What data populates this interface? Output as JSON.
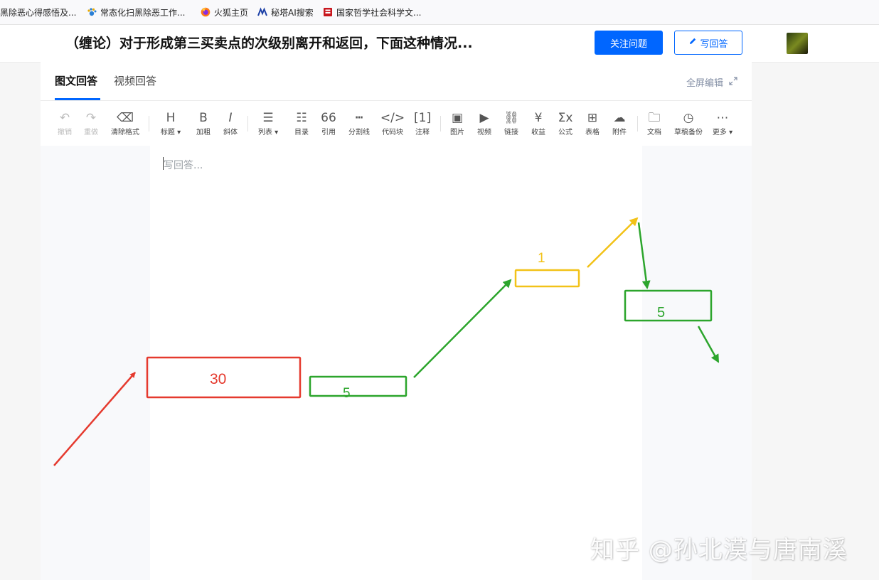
{
  "bookmarks": [
    {
      "icon": "page-icon",
      "label": "黑除恶心得感悟及..."
    },
    {
      "icon": "paw-icon",
      "label": "常态化扫黑除恶工作..."
    },
    {
      "icon": "firefox-icon",
      "label": "火狐主页"
    },
    {
      "icon": "metaso-icon",
      "label": "秘塔AI搜索"
    },
    {
      "icon": "cass-icon",
      "label": "国家哲学社会科学文..."
    }
  ],
  "question": {
    "title": "（缠论）对于形成第三买卖点的次级别离开和返回，下面这种情况...",
    "follow_label": "关注问题",
    "write_label": "写回答"
  },
  "editor": {
    "tabs": [
      "图文回答",
      "视频回答"
    ],
    "fullscreen_label": "全屏编辑",
    "placeholder": "写回答...",
    "toolbar": [
      {
        "icon": "undo-icon",
        "label": "撤销"
      },
      {
        "icon": "redo-icon",
        "label": "重做"
      },
      {
        "icon": "eraser-icon",
        "label": "清除格式"
      },
      {
        "icon": "heading-icon",
        "label": "标题"
      },
      {
        "icon": "bold-icon",
        "label": "加粗"
      },
      {
        "icon": "italic-icon",
        "label": "斜体"
      },
      {
        "icon": "list-icon",
        "label": "列表"
      },
      {
        "icon": "toc-icon",
        "label": "目录"
      },
      {
        "icon": "quote-icon",
        "label": "引用"
      },
      {
        "icon": "divider-icon",
        "label": "分割线"
      },
      {
        "icon": "code-icon",
        "label": "代码块"
      },
      {
        "icon": "footnote-icon",
        "label": "注释"
      },
      {
        "icon": "image-icon",
        "label": "图片"
      },
      {
        "icon": "video-icon",
        "label": "视频"
      },
      {
        "icon": "link-icon",
        "label": "链接"
      },
      {
        "icon": "money-bag-icon",
        "label": "收益"
      },
      {
        "icon": "formula-icon",
        "label": "公式"
      },
      {
        "icon": "table-icon",
        "label": "表格"
      },
      {
        "icon": "cloud-icon",
        "label": "附件"
      },
      {
        "icon": "folder-add-icon",
        "label": "文档"
      },
      {
        "icon": "clock-icon",
        "label": "草稿备份"
      },
      {
        "icon": "more-icon",
        "label": "更多"
      }
    ]
  },
  "drawing": {
    "box_labels": [
      "30",
      "5",
      "1",
      "5"
    ],
    "colors": {
      "red": "#e53a2e",
      "green": "#2ca52c",
      "yellow": "#f2c218"
    }
  },
  "watermark": "知乎 @孙北漠与唐南溪"
}
